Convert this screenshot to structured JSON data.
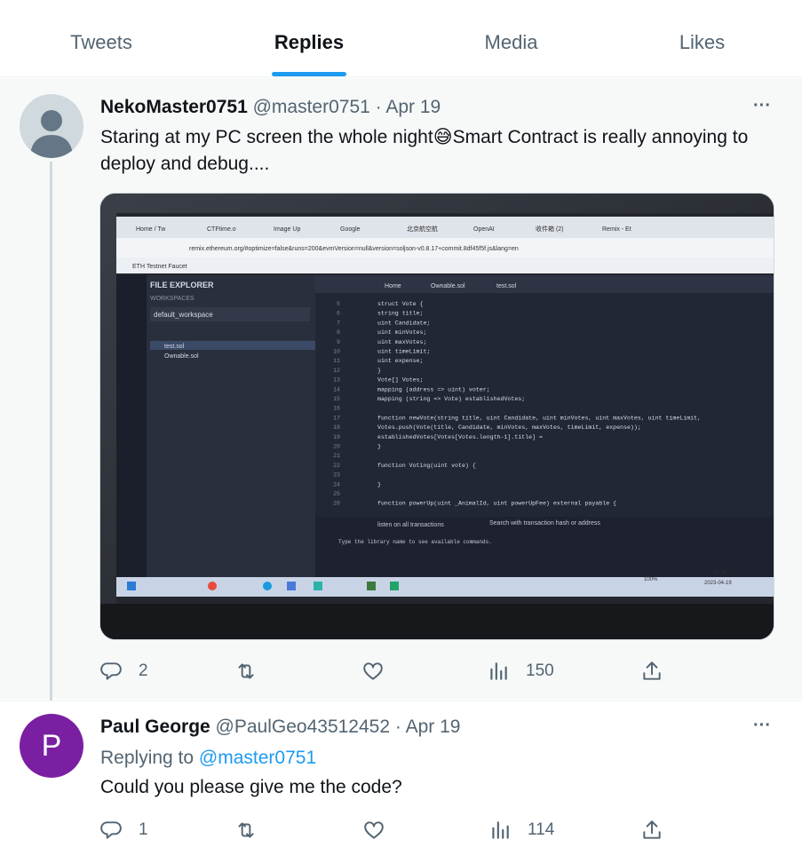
{
  "tabs": [
    {
      "label": "Tweets"
    },
    {
      "label": "Replies"
    },
    {
      "label": "Media"
    },
    {
      "label": "Likes"
    }
  ],
  "active_tab": "Replies",
  "tweets": [
    {
      "name": "NekoMaster0751",
      "handle": "@master0751",
      "time": "Apr 19",
      "text_before": "Staring at my PC screen the whole night",
      "emoji": "😅",
      "text_after": "Smart Contract is really annoying to deploy and debug....",
      "stats": {
        "replies": "2",
        "retweets": "",
        "likes": "",
        "views": "150"
      }
    },
    {
      "name": "Paul George",
      "handle": "@PaulGeo43512452",
      "time": "Apr 19",
      "replying_to_label": "Replying to",
      "replying_to_handle": "@master0751",
      "text": "Could you please give me the code?",
      "avatar_letter": "P",
      "stats": {
        "replies": "1",
        "retweets": "",
        "likes": "",
        "views": "114"
      }
    }
  ],
  "photo": {
    "browser_tabs": [
      "Home / Tw",
      "CTFtime.o",
      "Image Up",
      "Google",
      "北京航空航",
      "OpenAI",
      "收件箱 (2)",
      "Remix - Et"
    ],
    "url": "remix.ethereum.org/#optimize=false&runs=200&evmVersion=null&version=soljson-v0.8.17+commit.8df45f5f.js&lang=en",
    "bookmark": "ETH Testnet Faucet",
    "file_explorer_title": "FILE EXPLORER",
    "workspaces_label": "WORKSPACES",
    "workspace_name": "default_workspace",
    "files": [
      "test.sol",
      "Ownable.sol"
    ],
    "editor_tabs": [
      "Home",
      "Ownable.sol",
      "test.sol"
    ],
    "code_lines": [
      {
        "n": "5",
        "t": "struct Vote {"
      },
      {
        "n": "6",
        "t": "    string title;"
      },
      {
        "n": "7",
        "t": "    uint Candidate;"
      },
      {
        "n": "8",
        "t": "    uint minVotes;"
      },
      {
        "n": "9",
        "t": "    uint maxVotes;"
      },
      {
        "n": "10",
        "t": "    uint timeLimit;"
      },
      {
        "n": "11",
        "t": "    uint expense;"
      },
      {
        "n": "12",
        "t": "}"
      },
      {
        "n": "13",
        "t": "Vote[] Votes;"
      },
      {
        "n": "14",
        "t": "mapping (address => uint) voter;"
      },
      {
        "n": "15",
        "t": "mapping (string => Vote) establishedVotes;"
      },
      {
        "n": "16",
        "t": ""
      },
      {
        "n": "17",
        "t": "function newVote(string title, uint Candidate, uint minVotes, uint maxVotes, uint timeLimit,"
      },
      {
        "n": "18",
        "t": "    Votes.push(Vote(title, Candidate, minVotes, maxVotes, timeLimit, expense));"
      },
      {
        "n": "19",
        "t": "    establishedVotes[Votes[Votes.length-1].title] ="
      },
      {
        "n": "20",
        "t": "}"
      },
      {
        "n": "21",
        "t": ""
      },
      {
        "n": "22",
        "t": "function Voting(uint vote) {"
      },
      {
        "n": "23",
        "t": ""
      },
      {
        "n": "24",
        "t": "}"
      },
      {
        "n": "25",
        "t": ""
      },
      {
        "n": "26",
        "t": "function powerUp(uint _AnimalId, uint powerUpFee) external payable {"
      }
    ],
    "terminal_listen": "listen on all transactions",
    "terminal_search": "Search with transaction hash or address",
    "terminal_hint": "Type the library name to see available commands.",
    "clock_time": "23:39",
    "clock_date": "2023-04-19",
    "battery": "100%"
  },
  "colors": {
    "accent": "#1d9bf0",
    "muted": "#536471",
    "avatar_p": "#7b1fa2"
  }
}
